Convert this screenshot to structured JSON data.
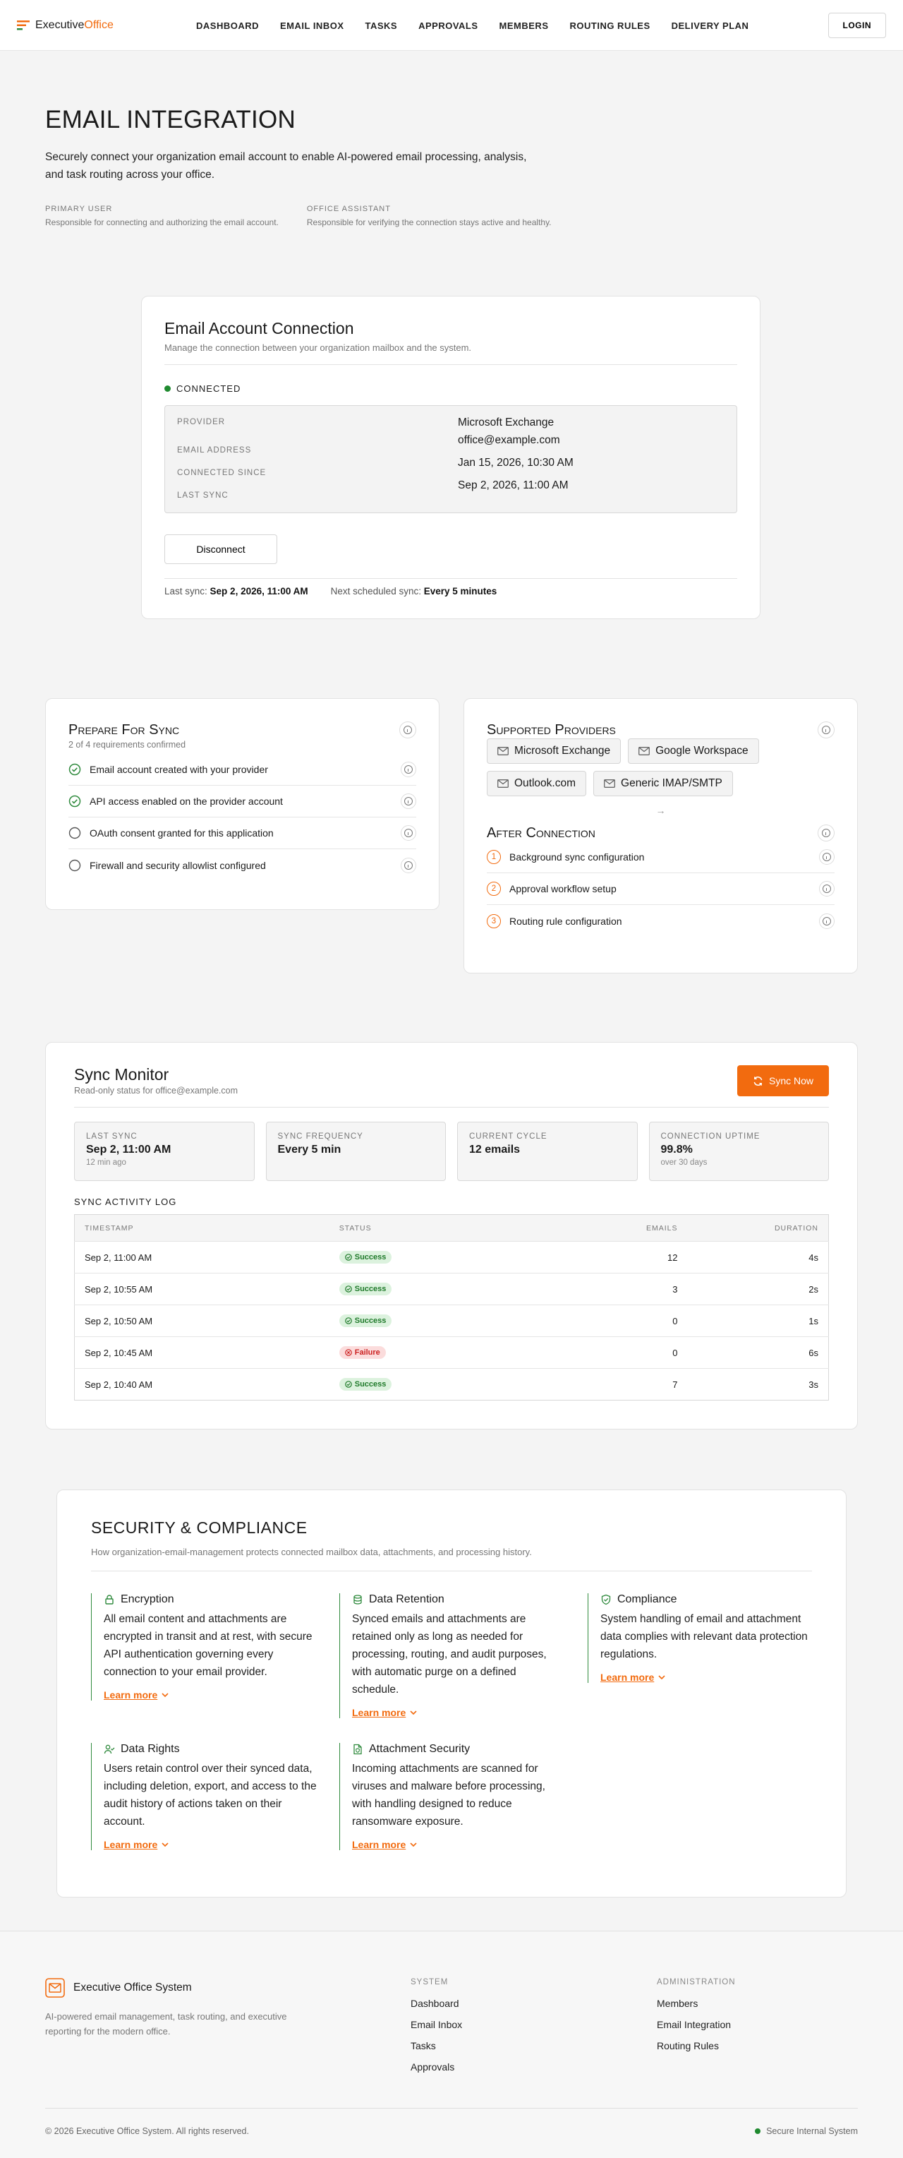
{
  "header": {
    "brand_part1": "Executive",
    "brand_part2": "Office",
    "nav": [
      "DASHBOARD",
      "EMAIL INBOX",
      "TASKS",
      "APPROVALS",
      "MEMBERS",
      "ROUTING RULES",
      "DELIVERY PLAN"
    ],
    "login": "LOGIN"
  },
  "hero": {
    "title": "EMAIL INTEGRATION",
    "description": "Securely connect your organization email account to enable AI-powered email processing, analysis, and task routing across your office.",
    "roles": [
      {
        "label": "PRIMARY USER",
        "desc": "Responsible for connecting and authorizing the email account."
      },
      {
        "label": "OFFICE ASSISTANT",
        "desc": "Responsible for verifying the connection stays active and healthy."
      }
    ]
  },
  "connection": {
    "title": "Email Account Connection",
    "subtitle": "Manage the connection between your organization mailbox and the system.",
    "status": "CONNECTED",
    "labels": [
      "PROVIDER",
      "EMAIL ADDRESS",
      "CONNECTED SINCE",
      "LAST SYNC"
    ],
    "values": [
      "Microsoft Exchange",
      "office@example.com",
      "Jan 15, 2026, 10:30 AM",
      "Sep 2, 2026, 11:00 AM"
    ],
    "disconnect": "Disconnect",
    "last_sync_label": "Last sync:",
    "last_sync_value": "Sep 2, 2026, 11:00 AM",
    "next_sync_label": "Next scheduled sync:",
    "next_sync_value": "Every 5 minutes"
  },
  "prepare": {
    "title": "Prepare For Sync",
    "subtitle": "2 of 4 requirements confirmed",
    "items": [
      {
        "label": "Email account created with your provider",
        "done": true
      },
      {
        "label": "API access enabled on the provider account",
        "done": true
      },
      {
        "label": "OAuth consent granted for this application",
        "done": false
      },
      {
        "label": "Firewall and security allowlist configured",
        "done": false
      }
    ]
  },
  "providers": {
    "title": "Supported Providers",
    "items": [
      "Microsoft Exchange",
      "Google Workspace",
      "Outlook.com",
      "Generic IMAP/SMTP"
    ],
    "after_title": "After Connection",
    "after_items": [
      {
        "n": "1",
        "label": "Background sync configuration"
      },
      {
        "n": "2",
        "label": "Approval workflow setup"
      },
      {
        "n": "3",
        "label": "Routing rule configuration"
      }
    ]
  },
  "monitor": {
    "title": "Sync Monitor",
    "subtitle": "Read-only status for office@example.com",
    "sync_button": "Sync Now",
    "stats": [
      {
        "label": "LAST SYNC",
        "value": "Sep 2, 11:00 AM",
        "sub": "12 min ago"
      },
      {
        "label": "SYNC FREQUENCY",
        "value": "Every 5 min",
        "sub": ""
      },
      {
        "label": "CURRENT CYCLE",
        "value": "12 emails",
        "sub": ""
      },
      {
        "label": "CONNECTION UPTIME",
        "value": "99.8%",
        "sub": "over 30 days"
      }
    ],
    "log_title": "SYNC ACTIVITY LOG",
    "columns": [
      "TIMESTAMP",
      "STATUS",
      "EMAILS",
      "DURATION"
    ],
    "rows": [
      {
        "time": "Sep 2, 11:00 AM",
        "status": "Success",
        "emails": "12",
        "duration": "4s"
      },
      {
        "time": "Sep 2, 10:55 AM",
        "status": "Success",
        "emails": "3",
        "duration": "2s"
      },
      {
        "time": "Sep 2, 10:50 AM",
        "status": "Success",
        "emails": "0",
        "duration": "1s"
      },
      {
        "time": "Sep 2, 10:45 AM",
        "status": "Failure",
        "emails": "0",
        "duration": "6s"
      },
      {
        "time": "Sep 2, 10:40 AM",
        "status": "Success",
        "emails": "7",
        "duration": "3s"
      }
    ]
  },
  "security": {
    "title": "SECURITY & COMPLIANCE",
    "subtitle": "How organization-email-management protects connected mailbox data, attachments, and processing history.",
    "learn_more": "Learn more",
    "features": [
      {
        "icon": "lock-icon",
        "title": "Encryption",
        "desc": "All email content and attachments are encrypted in transit and at rest, with secure API authentication governing every connection to your email provider."
      },
      {
        "icon": "database-icon",
        "title": "Data Retention",
        "desc": "Synced emails and attachments are retained only as long as needed for processing, routing, and audit purposes, with automatic purge on a defined schedule."
      },
      {
        "icon": "shield-check-icon",
        "title": "Compliance",
        "desc": "System handling of email and attachment data complies with relevant data protection regulations."
      },
      {
        "icon": "user-check-icon",
        "title": "Data Rights",
        "desc": "Users retain control over their synced data, including deletion, export, and access to the audit history of actions taken on their account."
      },
      {
        "icon": "file-shield-icon",
        "title": "Attachment Security",
        "desc": "Incoming attachments are scanned for viruses and malware before processing, with handling designed to reduce ransomware exposure."
      }
    ]
  },
  "footer": {
    "brand": "Executive Office System",
    "tagline": "AI-powered email management, task routing, and executive reporting for the modern office.",
    "system_title": "SYSTEM",
    "system_links": [
      "Dashboard",
      "Email Inbox",
      "Tasks",
      "Approvals"
    ],
    "admin_title": "ADMINISTRATION",
    "admin_links": [
      "Members",
      "Email Integration",
      "Routing Rules"
    ],
    "copyright": "© 2026 Executive Office System. All rights reserved.",
    "secure": "Secure Internal System"
  },
  "colors": {
    "accent": "#f26b0f",
    "success": "#1f8a2f",
    "failure": "#cc2222"
  }
}
